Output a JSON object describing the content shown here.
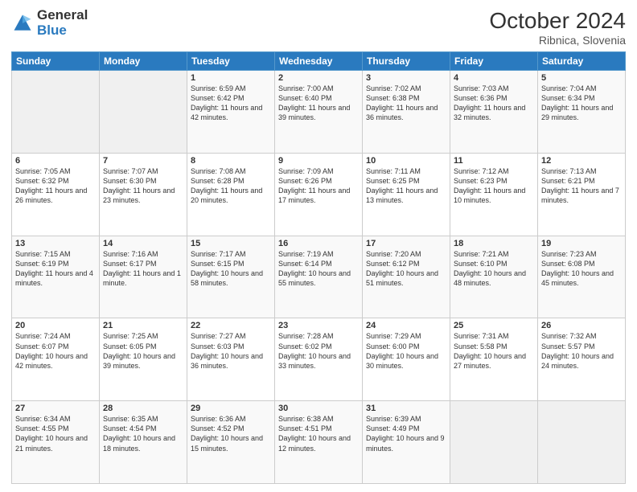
{
  "header": {
    "logo_general": "General",
    "logo_blue": "Blue",
    "month_title": "October 2024",
    "location": "Ribnica, Slovenia"
  },
  "weekdays": [
    "Sunday",
    "Monday",
    "Tuesday",
    "Wednesday",
    "Thursday",
    "Friday",
    "Saturday"
  ],
  "weeks": [
    [
      {
        "day": "",
        "info": ""
      },
      {
        "day": "",
        "info": ""
      },
      {
        "day": "1",
        "info": "Sunrise: 6:59 AM\nSunset: 6:42 PM\nDaylight: 11 hours and 42 minutes."
      },
      {
        "day": "2",
        "info": "Sunrise: 7:00 AM\nSunset: 6:40 PM\nDaylight: 11 hours and 39 minutes."
      },
      {
        "day": "3",
        "info": "Sunrise: 7:02 AM\nSunset: 6:38 PM\nDaylight: 11 hours and 36 minutes."
      },
      {
        "day": "4",
        "info": "Sunrise: 7:03 AM\nSunset: 6:36 PM\nDaylight: 11 hours and 32 minutes."
      },
      {
        "day": "5",
        "info": "Sunrise: 7:04 AM\nSunset: 6:34 PM\nDaylight: 11 hours and 29 minutes."
      }
    ],
    [
      {
        "day": "6",
        "info": "Sunrise: 7:05 AM\nSunset: 6:32 PM\nDaylight: 11 hours and 26 minutes."
      },
      {
        "day": "7",
        "info": "Sunrise: 7:07 AM\nSunset: 6:30 PM\nDaylight: 11 hours and 23 minutes."
      },
      {
        "day": "8",
        "info": "Sunrise: 7:08 AM\nSunset: 6:28 PM\nDaylight: 11 hours and 20 minutes."
      },
      {
        "day": "9",
        "info": "Sunrise: 7:09 AM\nSunset: 6:26 PM\nDaylight: 11 hours and 17 minutes."
      },
      {
        "day": "10",
        "info": "Sunrise: 7:11 AM\nSunset: 6:25 PM\nDaylight: 11 hours and 13 minutes."
      },
      {
        "day": "11",
        "info": "Sunrise: 7:12 AM\nSunset: 6:23 PM\nDaylight: 11 hours and 10 minutes."
      },
      {
        "day": "12",
        "info": "Sunrise: 7:13 AM\nSunset: 6:21 PM\nDaylight: 11 hours and 7 minutes."
      }
    ],
    [
      {
        "day": "13",
        "info": "Sunrise: 7:15 AM\nSunset: 6:19 PM\nDaylight: 11 hours and 4 minutes."
      },
      {
        "day": "14",
        "info": "Sunrise: 7:16 AM\nSunset: 6:17 PM\nDaylight: 11 hours and 1 minute."
      },
      {
        "day": "15",
        "info": "Sunrise: 7:17 AM\nSunset: 6:15 PM\nDaylight: 10 hours and 58 minutes."
      },
      {
        "day": "16",
        "info": "Sunrise: 7:19 AM\nSunset: 6:14 PM\nDaylight: 10 hours and 55 minutes."
      },
      {
        "day": "17",
        "info": "Sunrise: 7:20 AM\nSunset: 6:12 PM\nDaylight: 10 hours and 51 minutes."
      },
      {
        "day": "18",
        "info": "Sunrise: 7:21 AM\nSunset: 6:10 PM\nDaylight: 10 hours and 48 minutes."
      },
      {
        "day": "19",
        "info": "Sunrise: 7:23 AM\nSunset: 6:08 PM\nDaylight: 10 hours and 45 minutes."
      }
    ],
    [
      {
        "day": "20",
        "info": "Sunrise: 7:24 AM\nSunset: 6:07 PM\nDaylight: 10 hours and 42 minutes."
      },
      {
        "day": "21",
        "info": "Sunrise: 7:25 AM\nSunset: 6:05 PM\nDaylight: 10 hours and 39 minutes."
      },
      {
        "day": "22",
        "info": "Sunrise: 7:27 AM\nSunset: 6:03 PM\nDaylight: 10 hours and 36 minutes."
      },
      {
        "day": "23",
        "info": "Sunrise: 7:28 AM\nSunset: 6:02 PM\nDaylight: 10 hours and 33 minutes."
      },
      {
        "day": "24",
        "info": "Sunrise: 7:29 AM\nSunset: 6:00 PM\nDaylight: 10 hours and 30 minutes."
      },
      {
        "day": "25",
        "info": "Sunrise: 7:31 AM\nSunset: 5:58 PM\nDaylight: 10 hours and 27 minutes."
      },
      {
        "day": "26",
        "info": "Sunrise: 7:32 AM\nSunset: 5:57 PM\nDaylight: 10 hours and 24 minutes."
      }
    ],
    [
      {
        "day": "27",
        "info": "Sunrise: 6:34 AM\nSunset: 4:55 PM\nDaylight: 10 hours and 21 minutes."
      },
      {
        "day": "28",
        "info": "Sunrise: 6:35 AM\nSunset: 4:54 PM\nDaylight: 10 hours and 18 minutes."
      },
      {
        "day": "29",
        "info": "Sunrise: 6:36 AM\nSunset: 4:52 PM\nDaylight: 10 hours and 15 minutes."
      },
      {
        "day": "30",
        "info": "Sunrise: 6:38 AM\nSunset: 4:51 PM\nDaylight: 10 hours and 12 minutes."
      },
      {
        "day": "31",
        "info": "Sunrise: 6:39 AM\nSunset: 4:49 PM\nDaylight: 10 hours and 9 minutes."
      },
      {
        "day": "",
        "info": ""
      },
      {
        "day": "",
        "info": ""
      }
    ]
  ]
}
